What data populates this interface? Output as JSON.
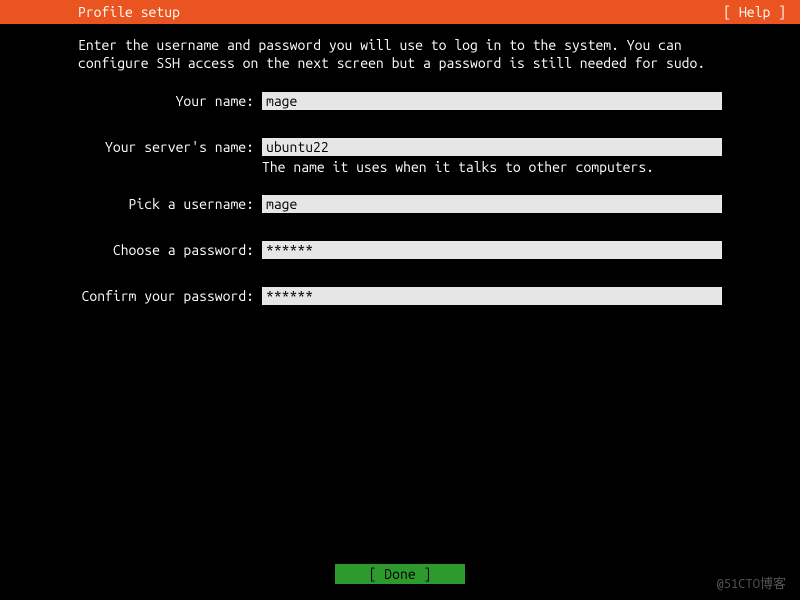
{
  "header": {
    "title": "Profile setup",
    "help": "[ Help ]"
  },
  "description": "Enter the username and password you will use to log in to the system. You can configure SSH access on the next screen but a password is still needed for sudo.",
  "fields": {
    "name": {
      "label": "Your name:",
      "value": "mage"
    },
    "server": {
      "label": "Your server's name:",
      "value": "ubuntu22",
      "hint": "The name it uses when it talks to other computers."
    },
    "username": {
      "label": "Pick a username:",
      "value": "mage"
    },
    "password": {
      "label": "Choose a password:",
      "value": "******"
    },
    "confirm": {
      "label": "Confirm your password:",
      "value": "******"
    }
  },
  "footer": {
    "done": "[ Done       ]"
  },
  "watermark": "@51CTO博客"
}
